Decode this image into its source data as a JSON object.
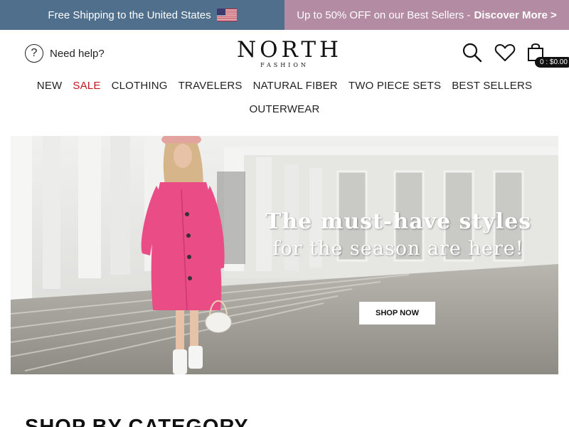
{
  "announcement": {
    "left_text": "Free Shipping to the United States",
    "flag_icon": "us-flag-icon",
    "right_text": "Up to 50% OFF on our Best Sellers -",
    "right_link": "Discover More >",
    "left_bg": "#4f6f8c",
    "right_bg": "#b38ba3"
  },
  "header": {
    "help_label": "Need help?",
    "logo_main": "NORTH",
    "logo_sub": "FASHION",
    "cart_count": "0",
    "cart_separator": ":",
    "cart_total": "$0.00"
  },
  "nav": {
    "items": [
      {
        "label": "NEW"
      },
      {
        "label": "SALE"
      },
      {
        "label": "CLOTHING"
      },
      {
        "label": "TRAVELERS"
      },
      {
        "label": "NATURAL FIBER"
      },
      {
        "label": "TWO PIECE SETS"
      },
      {
        "label": "BEST SELLERS"
      },
      {
        "label": "OUTERWEAR"
      }
    ],
    "sale_color": "#c0161f"
  },
  "hero": {
    "headline": "The must-have styles",
    "subheadline": "for the season are here!",
    "button_label": "SHOP NOW",
    "coat_color": "#ea4c86"
  },
  "section": {
    "title": "SHOP BY CATEGORY"
  }
}
